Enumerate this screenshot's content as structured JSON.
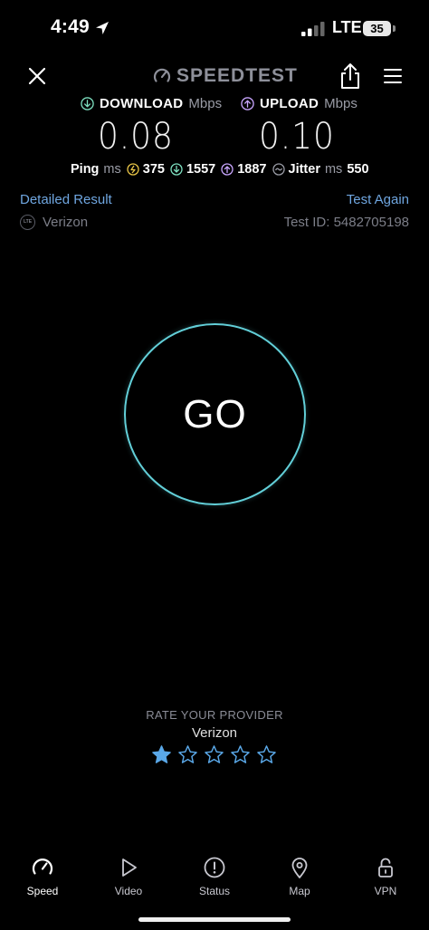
{
  "status_bar": {
    "time": "4:49",
    "network": "LTE",
    "battery": "35"
  },
  "header": {
    "logo_text": "SPEEDTEST"
  },
  "results": {
    "download": {
      "label": "DOWNLOAD",
      "unit": "Mbps",
      "value": "0.08",
      "accent": "#7ee0c0"
    },
    "upload": {
      "label": "UPLOAD",
      "unit": "Mbps",
      "value": "0.10",
      "accent": "#c9a6ff"
    },
    "ping_label": "Ping",
    "ms": "ms",
    "ping_idle": "375",
    "ping_down": "1557",
    "ping_up": "1887",
    "jitter_label": "Jitter",
    "jitter_value": "550"
  },
  "links": {
    "detailed": "Detailed Result",
    "test_again": "Test Again"
  },
  "provider": {
    "badge": "LTE",
    "name": "Verizon",
    "test_id": "Test ID: 5482705198"
  },
  "go_button": {
    "label": "GO",
    "ring_color": "#62cfd8"
  },
  "rating": {
    "title": "RATE YOUR PROVIDER",
    "provider": "Verizon",
    "stars_filled": 1,
    "stars_total": 5,
    "star_color": "#5aa8e8"
  },
  "nav": [
    {
      "label": "Speed",
      "icon": "speedometer-icon",
      "active": true
    },
    {
      "label": "Video",
      "icon": "play-icon",
      "active": false
    },
    {
      "label": "Status",
      "icon": "alert-icon",
      "active": false
    },
    {
      "label": "Map",
      "icon": "map-pin-icon",
      "active": false
    },
    {
      "label": "VPN",
      "icon": "unlock-icon",
      "active": false
    }
  ]
}
